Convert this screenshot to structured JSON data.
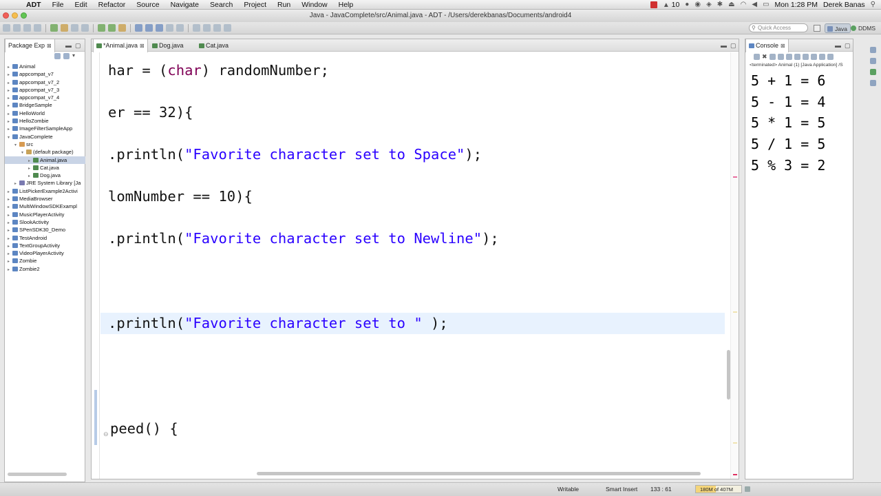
{
  "menubar": {
    "app": "ADT",
    "items": [
      "File",
      "Edit",
      "Refactor",
      "Source",
      "Navigate",
      "Search",
      "Project",
      "Run",
      "Window",
      "Help"
    ],
    "status_count": "10",
    "clock": "Mon 1:28 PM",
    "user": "Derek Banas"
  },
  "window": {
    "title": "Java - JavaComplete/src/Animal.java - ADT - /Users/derekbanas/Documents/android4"
  },
  "toolbar": {
    "quick_access_placeholder": "Quick Access",
    "perspective_java": "Java",
    "perspective_ddms": "DDMS"
  },
  "package_explorer": {
    "title": "Package Exp",
    "tree": [
      {
        "label": "Animal",
        "depth": 0,
        "icon": "project-icon"
      },
      {
        "label": "appcompat_v7",
        "depth": 0,
        "icon": "project-icon"
      },
      {
        "label": "appcompat_v7_2",
        "depth": 0,
        "icon": "project-icon"
      },
      {
        "label": "appcompat_v7_3",
        "depth": 0,
        "icon": "project-icon"
      },
      {
        "label": "appcompat_v7_4",
        "depth": 0,
        "icon": "project-icon"
      },
      {
        "label": "BridgeSample",
        "depth": 0,
        "icon": "project-icon"
      },
      {
        "label": "HelloWorld",
        "depth": 0,
        "icon": "project-icon"
      },
      {
        "label": "HelloZombie",
        "depth": 0,
        "icon": "project-icon"
      },
      {
        "label": "ImageFilterSampleApp",
        "depth": 0,
        "icon": "project-icon"
      },
      {
        "label": "JavaComplete",
        "depth": 0,
        "icon": "project-icon",
        "expanded": true
      },
      {
        "label": "src",
        "depth": 1,
        "icon": "source-folder-icon",
        "expanded": true
      },
      {
        "label": "(default package)",
        "depth": 2,
        "icon": "package-icon",
        "expanded": true
      },
      {
        "label": "Animal.java",
        "depth": 3,
        "icon": "java-file-icon",
        "selected": true
      },
      {
        "label": "Cat.java",
        "depth": 3,
        "icon": "java-file-icon"
      },
      {
        "label": "Dog.java",
        "depth": 3,
        "icon": "java-file-icon"
      },
      {
        "label": "JRE System Library [Ja",
        "depth": 1,
        "icon": "library-icon"
      },
      {
        "label": "ListPickerExample2Activi",
        "depth": 0,
        "icon": "project-icon"
      },
      {
        "label": "MediaBrowser",
        "depth": 0,
        "icon": "project-icon"
      },
      {
        "label": "MultiWindowSDKExampl",
        "depth": 0,
        "icon": "project-icon"
      },
      {
        "label": "MusicPlayerActivity",
        "depth": 0,
        "icon": "project-icon"
      },
      {
        "label": "SlookActivity",
        "depth": 0,
        "icon": "project-icon"
      },
      {
        "label": "SPenSDK30_Demo",
        "depth": 0,
        "icon": "project-icon"
      },
      {
        "label": "TestAndroid",
        "depth": 0,
        "icon": "project-icon"
      },
      {
        "label": "TextGroupActivity",
        "depth": 0,
        "icon": "project-icon"
      },
      {
        "label": "VideoPlayerActivity",
        "depth": 0,
        "icon": "project-icon"
      },
      {
        "label": "Zombie",
        "depth": 0,
        "icon": "project-icon"
      },
      {
        "label": "Zombie2",
        "depth": 0,
        "icon": "project-icon"
      }
    ]
  },
  "editor": {
    "tabs": [
      {
        "label": "*Animal.java",
        "active": true
      },
      {
        "label": "Dog.java",
        "active": false
      },
      {
        "label": "Cat.java",
        "active": false
      }
    ],
    "lines": [
      {
        "segments": [
          {
            "t": "har = (",
            "c": "plain"
          },
          {
            "t": "char",
            "c": "kw"
          },
          {
            "t": ") randomNumber;",
            "c": "plain"
          }
        ]
      },
      {
        "segments": [
          {
            "t": "er == 32){",
            "c": "plain"
          }
        ]
      },
      {
        "segments": [
          {
            "t": ".println(",
            "c": "plain"
          },
          {
            "t": "\"Favorite character set to Space\"",
            "c": "str"
          },
          {
            "t": ");",
            "c": "plain"
          }
        ]
      },
      {
        "segments": [
          {
            "t": "lomNumber == 10){",
            "c": "plain"
          }
        ]
      },
      {
        "segments": [
          {
            "t": ".println(",
            "c": "plain"
          },
          {
            "t": "\"Favorite character set to Newline\"",
            "c": "str"
          },
          {
            "t": ");",
            "c": "plain"
          }
        ]
      },
      {
        "segments": [
          {
            "t": ".println(",
            "c": "plain"
          },
          {
            "t": "\"Favorite character set to \"",
            "c": "str"
          },
          {
            "t": " );",
            "c": "plain"
          }
        ]
      },
      {
        "segments": [
          {
            "t": "peed() {",
            "c": "plain"
          }
        ]
      }
    ]
  },
  "console": {
    "title": "Console",
    "terminated": "<terminated> Animal (1) [Java Application] /S",
    "output": [
      "5 + 1 = 6",
      "5 - 1 = 4",
      "5 * 1 = 5",
      "5 / 1 = 5",
      "5 % 3 = 2"
    ]
  },
  "statusbar": {
    "writable": "Writable",
    "insert_mode": "Smart Insert",
    "position": "133 : 61",
    "heap": "180M of 407M",
    "heap_used_fraction": 0.44
  }
}
